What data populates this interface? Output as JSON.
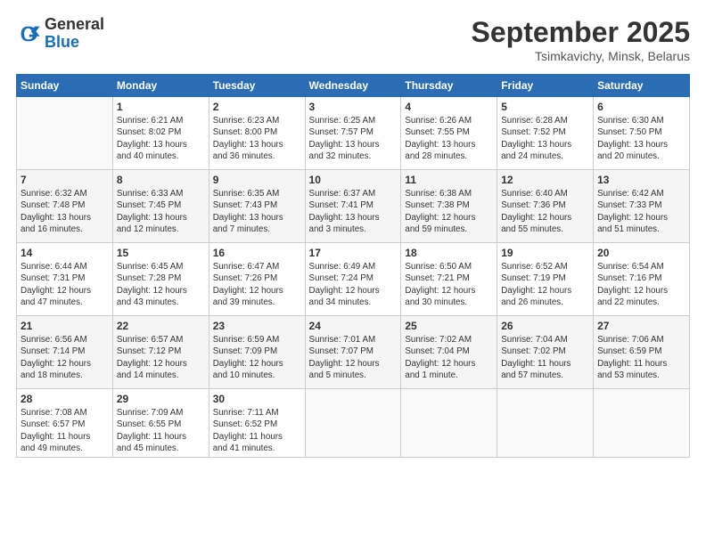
{
  "header": {
    "logo_general": "General",
    "logo_blue": "Blue",
    "month_title": "September 2025",
    "location": "Tsimkavichy, Minsk, Belarus"
  },
  "days_of_week": [
    "Sunday",
    "Monday",
    "Tuesday",
    "Wednesday",
    "Thursday",
    "Friday",
    "Saturday"
  ],
  "weeks": [
    [
      {
        "day": "",
        "content": ""
      },
      {
        "day": "1",
        "content": "Sunrise: 6:21 AM\nSunset: 8:02 PM\nDaylight: 13 hours\nand 40 minutes."
      },
      {
        "day": "2",
        "content": "Sunrise: 6:23 AM\nSunset: 8:00 PM\nDaylight: 13 hours\nand 36 minutes."
      },
      {
        "day": "3",
        "content": "Sunrise: 6:25 AM\nSunset: 7:57 PM\nDaylight: 13 hours\nand 32 minutes."
      },
      {
        "day": "4",
        "content": "Sunrise: 6:26 AM\nSunset: 7:55 PM\nDaylight: 13 hours\nand 28 minutes."
      },
      {
        "day": "5",
        "content": "Sunrise: 6:28 AM\nSunset: 7:52 PM\nDaylight: 13 hours\nand 24 minutes."
      },
      {
        "day": "6",
        "content": "Sunrise: 6:30 AM\nSunset: 7:50 PM\nDaylight: 13 hours\nand 20 minutes."
      }
    ],
    [
      {
        "day": "7",
        "content": "Sunrise: 6:32 AM\nSunset: 7:48 PM\nDaylight: 13 hours\nand 16 minutes."
      },
      {
        "day": "8",
        "content": "Sunrise: 6:33 AM\nSunset: 7:45 PM\nDaylight: 13 hours\nand 12 minutes."
      },
      {
        "day": "9",
        "content": "Sunrise: 6:35 AM\nSunset: 7:43 PM\nDaylight: 13 hours\nand 7 minutes."
      },
      {
        "day": "10",
        "content": "Sunrise: 6:37 AM\nSunset: 7:41 PM\nDaylight: 13 hours\nand 3 minutes."
      },
      {
        "day": "11",
        "content": "Sunrise: 6:38 AM\nSunset: 7:38 PM\nDaylight: 12 hours\nand 59 minutes."
      },
      {
        "day": "12",
        "content": "Sunrise: 6:40 AM\nSunset: 7:36 PM\nDaylight: 12 hours\nand 55 minutes."
      },
      {
        "day": "13",
        "content": "Sunrise: 6:42 AM\nSunset: 7:33 PM\nDaylight: 12 hours\nand 51 minutes."
      }
    ],
    [
      {
        "day": "14",
        "content": "Sunrise: 6:44 AM\nSunset: 7:31 PM\nDaylight: 12 hours\nand 47 minutes."
      },
      {
        "day": "15",
        "content": "Sunrise: 6:45 AM\nSunset: 7:28 PM\nDaylight: 12 hours\nand 43 minutes."
      },
      {
        "day": "16",
        "content": "Sunrise: 6:47 AM\nSunset: 7:26 PM\nDaylight: 12 hours\nand 39 minutes."
      },
      {
        "day": "17",
        "content": "Sunrise: 6:49 AM\nSunset: 7:24 PM\nDaylight: 12 hours\nand 34 minutes."
      },
      {
        "day": "18",
        "content": "Sunrise: 6:50 AM\nSunset: 7:21 PM\nDaylight: 12 hours\nand 30 minutes."
      },
      {
        "day": "19",
        "content": "Sunrise: 6:52 AM\nSunset: 7:19 PM\nDaylight: 12 hours\nand 26 minutes."
      },
      {
        "day": "20",
        "content": "Sunrise: 6:54 AM\nSunset: 7:16 PM\nDaylight: 12 hours\nand 22 minutes."
      }
    ],
    [
      {
        "day": "21",
        "content": "Sunrise: 6:56 AM\nSunset: 7:14 PM\nDaylight: 12 hours\nand 18 minutes."
      },
      {
        "day": "22",
        "content": "Sunrise: 6:57 AM\nSunset: 7:12 PM\nDaylight: 12 hours\nand 14 minutes."
      },
      {
        "day": "23",
        "content": "Sunrise: 6:59 AM\nSunset: 7:09 PM\nDaylight: 12 hours\nand 10 minutes."
      },
      {
        "day": "24",
        "content": "Sunrise: 7:01 AM\nSunset: 7:07 PM\nDaylight: 12 hours\nand 5 minutes."
      },
      {
        "day": "25",
        "content": "Sunrise: 7:02 AM\nSunset: 7:04 PM\nDaylight: 12 hours\nand 1 minute."
      },
      {
        "day": "26",
        "content": "Sunrise: 7:04 AM\nSunset: 7:02 PM\nDaylight: 11 hours\nand 57 minutes."
      },
      {
        "day": "27",
        "content": "Sunrise: 7:06 AM\nSunset: 6:59 PM\nDaylight: 11 hours\nand 53 minutes."
      }
    ],
    [
      {
        "day": "28",
        "content": "Sunrise: 7:08 AM\nSunset: 6:57 PM\nDaylight: 11 hours\nand 49 minutes."
      },
      {
        "day": "29",
        "content": "Sunrise: 7:09 AM\nSunset: 6:55 PM\nDaylight: 11 hours\nand 45 minutes."
      },
      {
        "day": "30",
        "content": "Sunrise: 7:11 AM\nSunset: 6:52 PM\nDaylight: 11 hours\nand 41 minutes."
      },
      {
        "day": "",
        "content": ""
      },
      {
        "day": "",
        "content": ""
      },
      {
        "day": "",
        "content": ""
      },
      {
        "day": "",
        "content": ""
      }
    ]
  ]
}
